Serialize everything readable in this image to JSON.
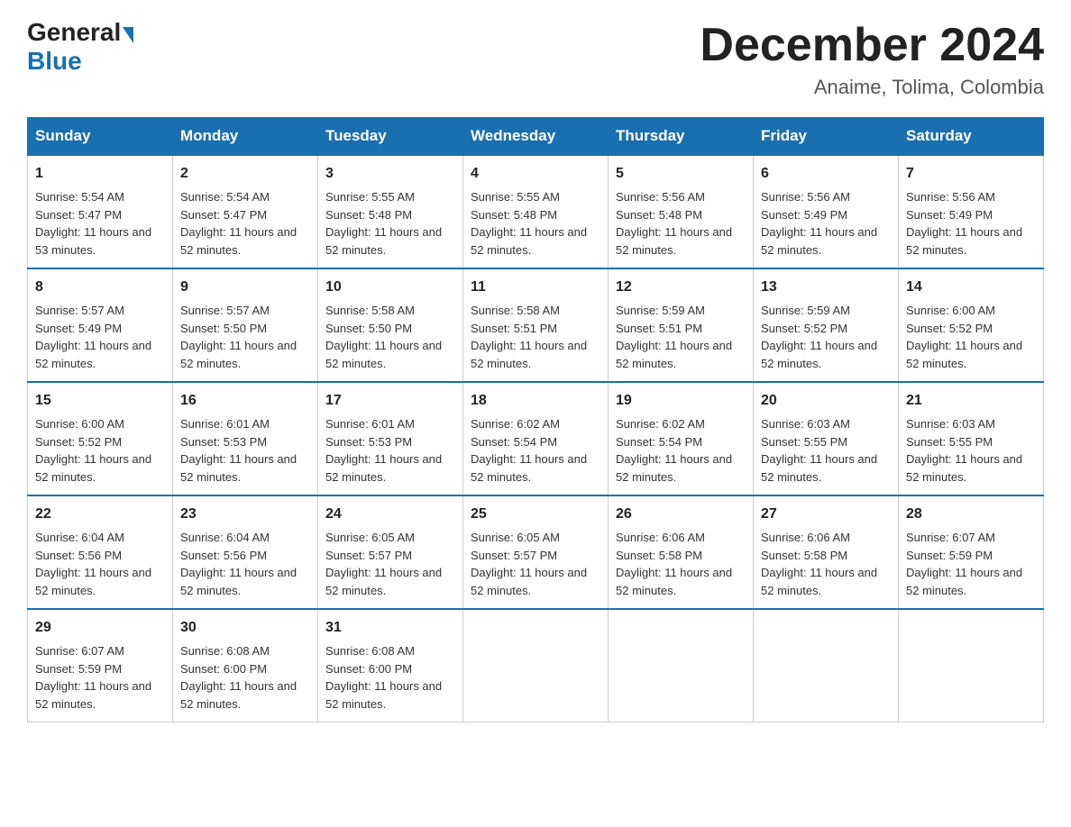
{
  "logo": {
    "general": "General",
    "blue": "Blue"
  },
  "title": "December 2024",
  "location": "Anaime, Tolima, Colombia",
  "days_of_week": [
    "Sunday",
    "Monday",
    "Tuesday",
    "Wednesday",
    "Thursday",
    "Friday",
    "Saturday"
  ],
  "weeks": [
    [
      {
        "day": "1",
        "sunrise": "5:54 AM",
        "sunset": "5:47 PM",
        "daylight": "11 hours and 53 minutes."
      },
      {
        "day": "2",
        "sunrise": "5:54 AM",
        "sunset": "5:47 PM",
        "daylight": "11 hours and 52 minutes."
      },
      {
        "day": "3",
        "sunrise": "5:55 AM",
        "sunset": "5:48 PM",
        "daylight": "11 hours and 52 minutes."
      },
      {
        "day": "4",
        "sunrise": "5:55 AM",
        "sunset": "5:48 PM",
        "daylight": "11 hours and 52 minutes."
      },
      {
        "day": "5",
        "sunrise": "5:56 AM",
        "sunset": "5:48 PM",
        "daylight": "11 hours and 52 minutes."
      },
      {
        "day": "6",
        "sunrise": "5:56 AM",
        "sunset": "5:49 PM",
        "daylight": "11 hours and 52 minutes."
      },
      {
        "day": "7",
        "sunrise": "5:56 AM",
        "sunset": "5:49 PM",
        "daylight": "11 hours and 52 minutes."
      }
    ],
    [
      {
        "day": "8",
        "sunrise": "5:57 AM",
        "sunset": "5:49 PM",
        "daylight": "11 hours and 52 minutes."
      },
      {
        "day": "9",
        "sunrise": "5:57 AM",
        "sunset": "5:50 PM",
        "daylight": "11 hours and 52 minutes."
      },
      {
        "day": "10",
        "sunrise": "5:58 AM",
        "sunset": "5:50 PM",
        "daylight": "11 hours and 52 minutes."
      },
      {
        "day": "11",
        "sunrise": "5:58 AM",
        "sunset": "5:51 PM",
        "daylight": "11 hours and 52 minutes."
      },
      {
        "day": "12",
        "sunrise": "5:59 AM",
        "sunset": "5:51 PM",
        "daylight": "11 hours and 52 minutes."
      },
      {
        "day": "13",
        "sunrise": "5:59 AM",
        "sunset": "5:52 PM",
        "daylight": "11 hours and 52 minutes."
      },
      {
        "day": "14",
        "sunrise": "6:00 AM",
        "sunset": "5:52 PM",
        "daylight": "11 hours and 52 minutes."
      }
    ],
    [
      {
        "day": "15",
        "sunrise": "6:00 AM",
        "sunset": "5:52 PM",
        "daylight": "11 hours and 52 minutes."
      },
      {
        "day": "16",
        "sunrise": "6:01 AM",
        "sunset": "5:53 PM",
        "daylight": "11 hours and 52 minutes."
      },
      {
        "day": "17",
        "sunrise": "6:01 AM",
        "sunset": "5:53 PM",
        "daylight": "11 hours and 52 minutes."
      },
      {
        "day": "18",
        "sunrise": "6:02 AM",
        "sunset": "5:54 PM",
        "daylight": "11 hours and 52 minutes."
      },
      {
        "day": "19",
        "sunrise": "6:02 AM",
        "sunset": "5:54 PM",
        "daylight": "11 hours and 52 minutes."
      },
      {
        "day": "20",
        "sunrise": "6:03 AM",
        "sunset": "5:55 PM",
        "daylight": "11 hours and 52 minutes."
      },
      {
        "day": "21",
        "sunrise": "6:03 AM",
        "sunset": "5:55 PM",
        "daylight": "11 hours and 52 minutes."
      }
    ],
    [
      {
        "day": "22",
        "sunrise": "6:04 AM",
        "sunset": "5:56 PM",
        "daylight": "11 hours and 52 minutes."
      },
      {
        "day": "23",
        "sunrise": "6:04 AM",
        "sunset": "5:56 PM",
        "daylight": "11 hours and 52 minutes."
      },
      {
        "day": "24",
        "sunrise": "6:05 AM",
        "sunset": "5:57 PM",
        "daylight": "11 hours and 52 minutes."
      },
      {
        "day": "25",
        "sunrise": "6:05 AM",
        "sunset": "5:57 PM",
        "daylight": "11 hours and 52 minutes."
      },
      {
        "day": "26",
        "sunrise": "6:06 AM",
        "sunset": "5:58 PM",
        "daylight": "11 hours and 52 minutes."
      },
      {
        "day": "27",
        "sunrise": "6:06 AM",
        "sunset": "5:58 PM",
        "daylight": "11 hours and 52 minutes."
      },
      {
        "day": "28",
        "sunrise": "6:07 AM",
        "sunset": "5:59 PM",
        "daylight": "11 hours and 52 minutes."
      }
    ],
    [
      {
        "day": "29",
        "sunrise": "6:07 AM",
        "sunset": "5:59 PM",
        "daylight": "11 hours and 52 minutes."
      },
      {
        "day": "30",
        "sunrise": "6:08 AM",
        "sunset": "6:00 PM",
        "daylight": "11 hours and 52 minutes."
      },
      {
        "day": "31",
        "sunrise": "6:08 AM",
        "sunset": "6:00 PM",
        "daylight": "11 hours and 52 minutes."
      },
      null,
      null,
      null,
      null
    ]
  ]
}
